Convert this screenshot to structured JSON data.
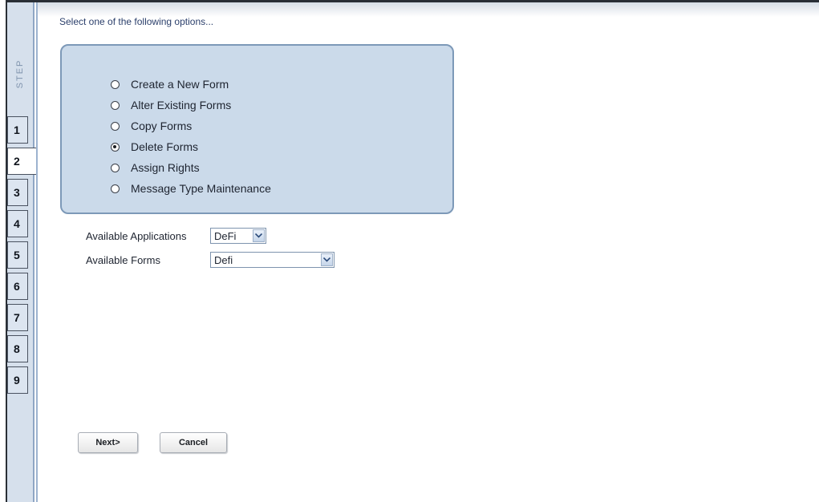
{
  "sidebar": {
    "step_label": "STEP",
    "steps": [
      "1",
      "2",
      "3",
      "4",
      "5",
      "6",
      "7",
      "8",
      "9"
    ],
    "active_step": "2"
  },
  "main": {
    "prompt": "Select one of the following options...",
    "options": [
      {
        "label": "Create a New Form",
        "selected": false
      },
      {
        "label": "Alter Existing Forms",
        "selected": false
      },
      {
        "label": "Copy Forms",
        "selected": false
      },
      {
        "label": "Delete Forms",
        "selected": true
      },
      {
        "label": "Assign Rights",
        "selected": false
      },
      {
        "label": "Message Type Maintenance",
        "selected": false
      }
    ],
    "fields": {
      "applications": {
        "label": "Available Applications",
        "value": "DeFi"
      },
      "forms": {
        "label": "Available Forms",
        "value": "Defi"
      }
    }
  },
  "buttons": {
    "next": "Next>",
    "cancel": "Cancel"
  },
  "colors": {
    "panel_bg": "#cbdaea",
    "panel_border": "#7d99b8",
    "sidebar_bg": "#d6e0ec",
    "prompt_text": "#2b3f6b"
  }
}
